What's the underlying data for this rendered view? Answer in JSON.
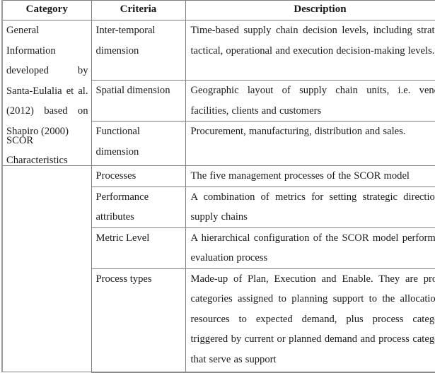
{
  "table": {
    "headers": {
      "category": "Category",
      "criteria": "Criteria",
      "description": "Description"
    },
    "groups": [
      {
        "category": "General Information developed by Santa-Eulalia et al.(2012) based on Shapiro (2000)",
        "rows": [
          {
            "criteria": "Inter-temporal dimension",
            "description": "Time-based supply chain decision levels, including strategic, tactical, operational and execution decision-making levels."
          },
          {
            "criteria": "Spatial dimension",
            "description": "Geographic layout of supply chain units, i.e. vendors, facilities, clients and customers"
          },
          {
            "criteria": "Functional dimension",
            "description": "Procurement, manufacturing, distribution and sales."
          }
        ]
      },
      {
        "category": "SCOR Characteristics",
        "rows": [
          {
            "criteria": "Processes",
            "description": "The five management processes of the SCOR model"
          },
          {
            "criteria": "Performance attributes",
            "description": "A combination of metrics for setting strategic direction of supply chains"
          },
          {
            "criteria": "Metric Level",
            "description": "A hierarchical configuration of the SCOR model performance evaluation process"
          },
          {
            "criteria": "Process types",
            "description": "Made-up of Plan, Execution and Enable. They are process categories assigned to planning support to the allocation of resources to expected demand, plus process categories triggered by current or planned demand and process categories that serve as support"
          }
        ]
      }
    ]
  }
}
